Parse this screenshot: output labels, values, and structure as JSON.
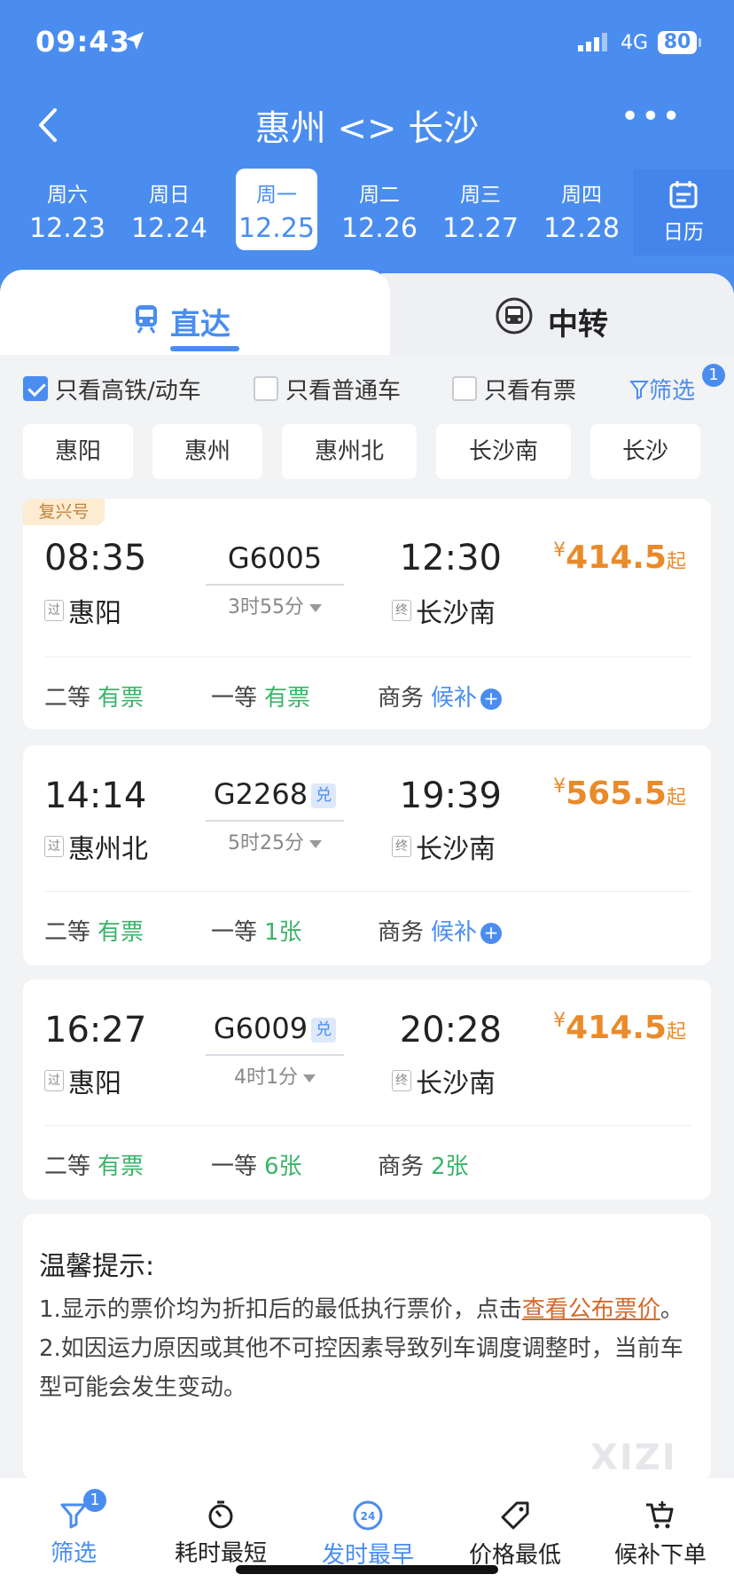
{
  "status": {
    "time": "09:43",
    "network": "4G",
    "battery": "80"
  },
  "nav": {
    "title": "惠州 <> 长沙"
  },
  "dates": [
    {
      "weekday": "周六",
      "date": "12.23"
    },
    {
      "weekday": "周日",
      "date": "12.24"
    },
    {
      "weekday": "周一",
      "date": "12.25",
      "active": true
    },
    {
      "weekday": "周二",
      "date": "12.26"
    },
    {
      "weekday": "周三",
      "date": "12.27"
    },
    {
      "weekday": "周四",
      "date": "12.28"
    }
  ],
  "calendar_label": "日历",
  "tabs": {
    "direct": "直达",
    "transfer": "中转"
  },
  "filters": {
    "high_speed_only": "只看高铁/动车",
    "normal_only": "只看普通车",
    "available_only": "只看有票",
    "filter_label": "筛选",
    "filter_badge": "1"
  },
  "stations": [
    "惠阳",
    "惠州",
    "惠州北",
    "长沙南",
    "长沙"
  ],
  "trains": [
    {
      "tag": "复兴号",
      "dep_time": "08:35",
      "dep_tag": "过",
      "dep_station": "惠阳",
      "train_no": "G6005",
      "exchange": "",
      "duration": "3时55分",
      "arr_time": "12:30",
      "arr_tag": "终",
      "arr_station": "长沙南",
      "price_symbol": "¥",
      "price": "414.5",
      "price_suffix": "起",
      "seats": [
        {
          "class": "二等",
          "status": "有票"
        },
        {
          "class": "一等",
          "status": "有票"
        },
        {
          "class": "商务",
          "status": "候补"
        }
      ]
    },
    {
      "tag": "",
      "dep_time": "14:14",
      "dep_tag": "过",
      "dep_station": "惠州北",
      "train_no": "G2268",
      "exchange": "兑",
      "duration": "5时25分",
      "arr_time": "19:39",
      "arr_tag": "终",
      "arr_station": "长沙南",
      "price_symbol": "¥",
      "price": "565.5",
      "price_suffix": "起",
      "seats": [
        {
          "class": "二等",
          "status": "有票"
        },
        {
          "class": "一等",
          "status": "1张"
        },
        {
          "class": "商务",
          "status": "候补"
        }
      ]
    },
    {
      "tag": "",
      "dep_time": "16:27",
      "dep_tag": "过",
      "dep_station": "惠阳",
      "train_no": "G6009",
      "exchange": "兑",
      "duration": "4时1分",
      "arr_time": "20:28",
      "arr_tag": "终",
      "arr_station": "长沙南",
      "price_symbol": "¥",
      "price": "414.5",
      "price_suffix": "起",
      "seats": [
        {
          "class": "二等",
          "status": "有票"
        },
        {
          "class": "一等",
          "status": "6张"
        },
        {
          "class": "商务",
          "status": "2张"
        }
      ]
    }
  ],
  "tips": {
    "title": "温馨提示:",
    "line1_prefix": "1.显示的票价均为折扣后的最低执行票价，点击",
    "line1_link": "查看公布票价",
    "line1_suffix": "。",
    "line2": "2.如因运力原因或其他不可控因素导致列车调度调整时，当前车型可能会发生变动。"
  },
  "watermark": "XIZI",
  "bottom_bar": [
    {
      "label": "筛选",
      "badge": "1",
      "icon": "filter-icon"
    },
    {
      "label": "耗时最短",
      "icon": "stopwatch-icon"
    },
    {
      "label": "发时最早",
      "icon": "clock-24-icon",
      "icon_text": "24"
    },
    {
      "label": "价格最低",
      "icon": "price-tag-icon"
    },
    {
      "label": "候补下单",
      "icon": "cart-plus-icon"
    }
  ],
  "colors": {
    "primary": "#4a8def",
    "price": "#e98a2b",
    "available": "#3bb469"
  }
}
